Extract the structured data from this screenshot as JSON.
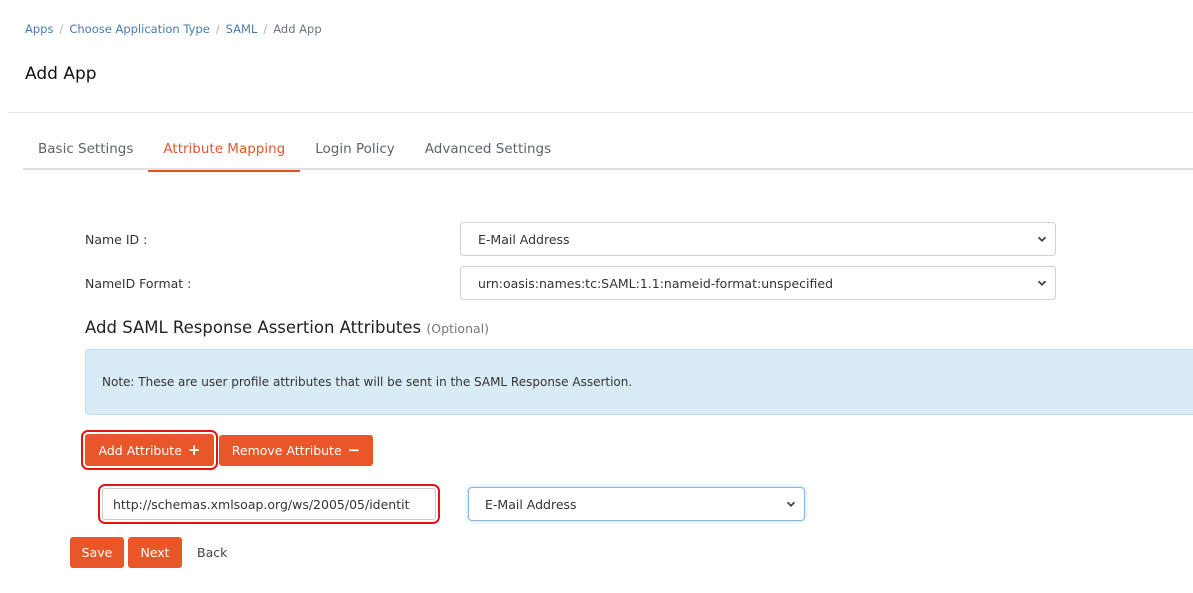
{
  "breadcrumb": {
    "items": [
      "Apps",
      "Choose Application Type",
      "SAML"
    ],
    "current": "Add App",
    "separator": "/"
  },
  "page": {
    "title": "Add App"
  },
  "tabs": [
    {
      "label": "Basic Settings",
      "active": false
    },
    {
      "label": "Attribute Mapping",
      "active": true
    },
    {
      "label": "Login Policy",
      "active": false
    },
    {
      "label": "Advanced Settings",
      "active": false
    }
  ],
  "form": {
    "name_id": {
      "label": "Name ID :",
      "value": "E-Mail Address"
    },
    "nameid_format": {
      "label": "NameID Format :",
      "value": "urn:oasis:names:tc:SAML:1.1:nameid-format:unspecified"
    }
  },
  "section": {
    "title": "Add SAML Response Assertion Attributes",
    "optional": "(Optional)",
    "note": "Note: These are user profile attributes that will be sent in the SAML Response Assertion."
  },
  "buttons": {
    "add_attribute": "Add Attribute",
    "remove_attribute": "Remove Attribute",
    "save": "Save",
    "next": "Next",
    "back": "Back"
  },
  "icons": {
    "plus": "+",
    "minus": "−"
  },
  "attribute_row": {
    "name_value": "http://schemas.xmlsoap.org/ws/2005/05/identit",
    "mapped_value": "E-Mail Address"
  },
  "colors": {
    "accent": "#e8562a",
    "active_tab": "#e2582a",
    "link": "#4a7ab0",
    "note_bg": "#d9ebf7",
    "highlight": "#e01515"
  }
}
